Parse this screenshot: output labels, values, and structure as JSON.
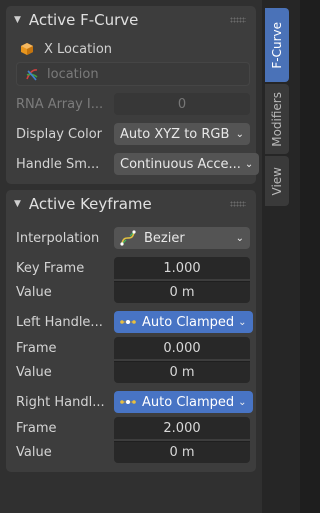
{
  "curve_section": {
    "title": "Active F-Curve",
    "object_name": "X Location",
    "data_path": "location",
    "rna_array_label": "RNA Array I...",
    "rna_array_value": "0",
    "display_color_label": "Display Color",
    "display_color_value": "Auto XYZ to RGB",
    "handle_smoothing_label": "Handle Sm...",
    "handle_smoothing_value": "Continuous Acce..."
  },
  "keyframe_section": {
    "title": "Active Keyframe",
    "interpolation_label": "Interpolation",
    "interpolation_value": "Bezier",
    "key_frame_label": "Key Frame",
    "key_frame_value": "1.000",
    "value_label": "Value",
    "value_value": "0 m",
    "left_handle_label": "Left Handle...",
    "left_handle_type": "Auto Clamped",
    "left_frame_label": "Frame",
    "left_frame_value": "0.000",
    "left_value_label": "Value",
    "left_value_value": "0 m",
    "right_handle_label": "Right Handl...",
    "right_handle_type": "Auto Clamped",
    "right_frame_label": "Frame",
    "right_frame_value": "2.000",
    "right_value_label": "Value",
    "right_value_value": "0 m"
  },
  "tabs": [
    {
      "label": "F-Curve",
      "active": true
    },
    {
      "label": "Modifiers",
      "active": false
    },
    {
      "label": "View",
      "active": false
    }
  ],
  "colors": {
    "accent": "#4874c4",
    "panel": "#3d3d3d",
    "object_icon": "#e8961e"
  },
  "icons": {
    "object": "cube-icon",
    "path": "rna-path-icon",
    "interpolation": "bezier-curve-icon",
    "handle": "handle-icon"
  }
}
